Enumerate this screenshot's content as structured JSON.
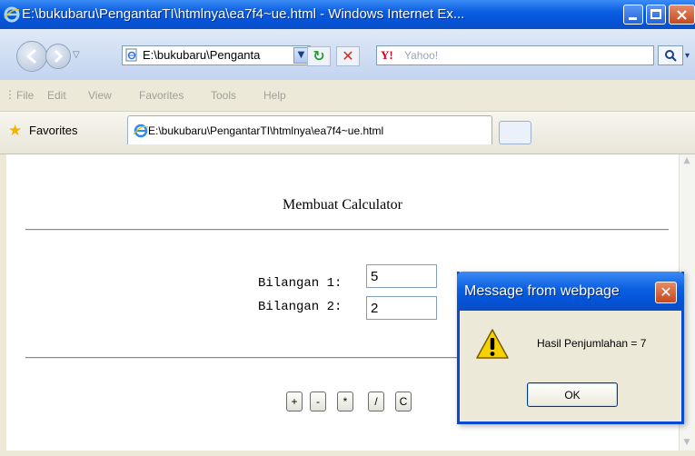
{
  "window": {
    "title": "E:\\bukubaru\\PengantarTI\\htmlnya\\ea7f4~ue.html - Windows Internet Ex...",
    "minimize_icon": "minimize-icon",
    "maximize_icon": "maximize-icon",
    "close_icon": "close-icon"
  },
  "addressbar": {
    "url": "E:\\bukubaru\\Penganta",
    "search_placeholder": "Yahoo!",
    "search_logo": "Y!",
    "refresh_glyph": "↻",
    "stop_glyph": "✕"
  },
  "menubar": {
    "items": [
      "File",
      "Edit",
      "View",
      "Favorites",
      "Tools",
      "Help"
    ]
  },
  "favorites": {
    "label": "Favorites",
    "tab_title": "E:\\bukubaru\\PengantarTI\\htmlnya\\ea7f4~ue.html"
  },
  "page": {
    "title": "Membuat Calculator",
    "label1": "Bilangan 1:",
    "label2": "Bilangan 2:",
    "value1": "5",
    "value2": "2",
    "buttons": [
      "+",
      "-",
      "*",
      "/",
      "C"
    ]
  },
  "dialog": {
    "title": "Message from webpage",
    "message": "Hasil Penjumlahan = 7",
    "ok_label": "OK",
    "close_glyph": "✕"
  },
  "colors": {
    "titlebar": "#0a5fe0",
    "chrome": "#ece9d8",
    "close_red": "#c4481f",
    "warning_yellow": "#f6d100"
  }
}
